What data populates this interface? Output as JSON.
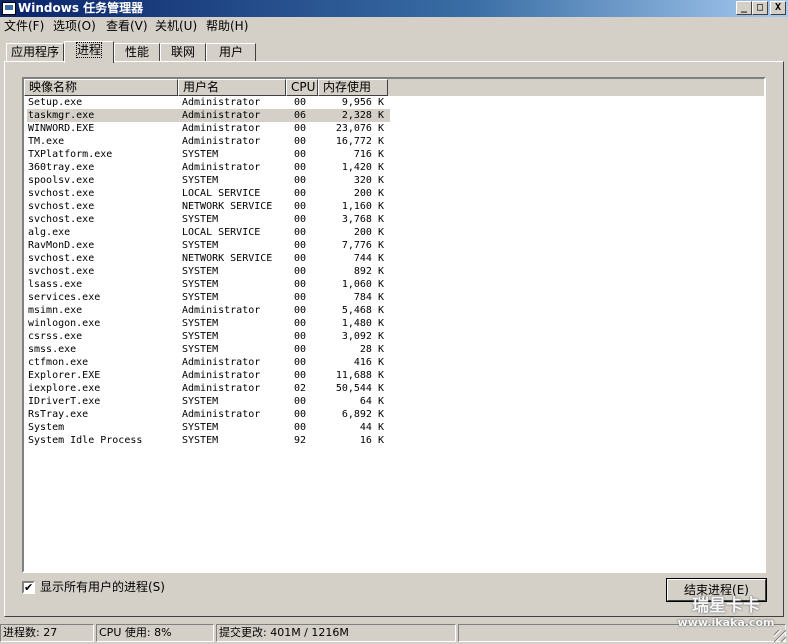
{
  "window": {
    "title": "Windows 任务管理器",
    "minimize_glyph": "_",
    "maximize_glyph": "□",
    "close_glyph": "X"
  },
  "menu": [
    "文件(F)",
    "选项(O)",
    "查看(V)",
    "关机(U)",
    "帮助(H)"
  ],
  "tabs": [
    "应用程序",
    "进程",
    "性能",
    "联网",
    "用户"
  ],
  "active_tab": "进程",
  "columns": [
    "映像名称",
    "用户名",
    "CPU",
    "内存使用"
  ],
  "processes": [
    {
      "name": "Setup.exe",
      "user": "Administrator",
      "cpu": "00",
      "mem": "9,956 K"
    },
    {
      "name": "taskmgr.exe",
      "user": "Administrator",
      "cpu": "06",
      "mem": "2,328 K"
    },
    {
      "name": "WINWORD.EXE",
      "user": "Administrator",
      "cpu": "00",
      "mem": "23,076 K"
    },
    {
      "name": "TM.exe",
      "user": "Administrator",
      "cpu": "00",
      "mem": "16,772 K"
    },
    {
      "name": "TXPlatform.exe",
      "user": "SYSTEM",
      "cpu": "00",
      "mem": "716 K"
    },
    {
      "name": "360tray.exe",
      "user": "Administrator",
      "cpu": "00",
      "mem": "1,420 K"
    },
    {
      "name": "spoolsv.exe",
      "user": "SYSTEM",
      "cpu": "00",
      "mem": "320 K"
    },
    {
      "name": "svchost.exe",
      "user": "LOCAL SERVICE",
      "cpu": "00",
      "mem": "200 K"
    },
    {
      "name": "svchost.exe",
      "user": "NETWORK SERVICE",
      "cpu": "00",
      "mem": "1,160 K"
    },
    {
      "name": "svchost.exe",
      "user": "SYSTEM",
      "cpu": "00",
      "mem": "3,768 K"
    },
    {
      "name": "alg.exe",
      "user": "LOCAL SERVICE",
      "cpu": "00",
      "mem": "200 K"
    },
    {
      "name": "RavMonD.exe",
      "user": "SYSTEM",
      "cpu": "00",
      "mem": "7,776 K"
    },
    {
      "name": "svchost.exe",
      "user": "NETWORK SERVICE",
      "cpu": "00",
      "mem": "744 K"
    },
    {
      "name": "svchost.exe",
      "user": "SYSTEM",
      "cpu": "00",
      "mem": "892 K"
    },
    {
      "name": "lsass.exe",
      "user": "SYSTEM",
      "cpu": "00",
      "mem": "1,060 K"
    },
    {
      "name": "services.exe",
      "user": "SYSTEM",
      "cpu": "00",
      "mem": "784 K"
    },
    {
      "name": "msimn.exe",
      "user": "Administrator",
      "cpu": "00",
      "mem": "5,468 K"
    },
    {
      "name": "winlogon.exe",
      "user": "SYSTEM",
      "cpu": "00",
      "mem": "1,480 K"
    },
    {
      "name": "csrss.exe",
      "user": "SYSTEM",
      "cpu": "00",
      "mem": "3,092 K"
    },
    {
      "name": "smss.exe",
      "user": "SYSTEM",
      "cpu": "00",
      "mem": "28 K"
    },
    {
      "name": "ctfmon.exe",
      "user": "Administrator",
      "cpu": "00",
      "mem": "416 K"
    },
    {
      "name": "Explorer.EXE",
      "user": "Administrator",
      "cpu": "00",
      "mem": "11,688 K"
    },
    {
      "name": "iexplore.exe",
      "user": "Administrator",
      "cpu": "02",
      "mem": "50,544 K"
    },
    {
      "name": "IDriverT.exe",
      "user": "SYSTEM",
      "cpu": "00",
      "mem": "64 K"
    },
    {
      "name": "RsTray.exe",
      "user": "Administrator",
      "cpu": "00",
      "mem": "6,892 K"
    },
    {
      "name": "System",
      "user": "SYSTEM",
      "cpu": "00",
      "mem": "44 K"
    },
    {
      "name": "System Idle Process",
      "user": "SYSTEM",
      "cpu": "92",
      "mem": "16 K"
    }
  ],
  "selected_row": 1,
  "show_all_users": {
    "label": "显示所有用户的进程(S)",
    "checked": true,
    "check_glyph": "✔"
  },
  "end_process_button": "结束进程(E)",
  "status": {
    "processes": "进程数: 27",
    "cpu": "CPU 使用: 8%",
    "commit": "提交更改: 401M / 1216M"
  },
  "watermark": {
    "line1": "瑞星卡卡",
    "line2": "www.ikaka.com"
  }
}
